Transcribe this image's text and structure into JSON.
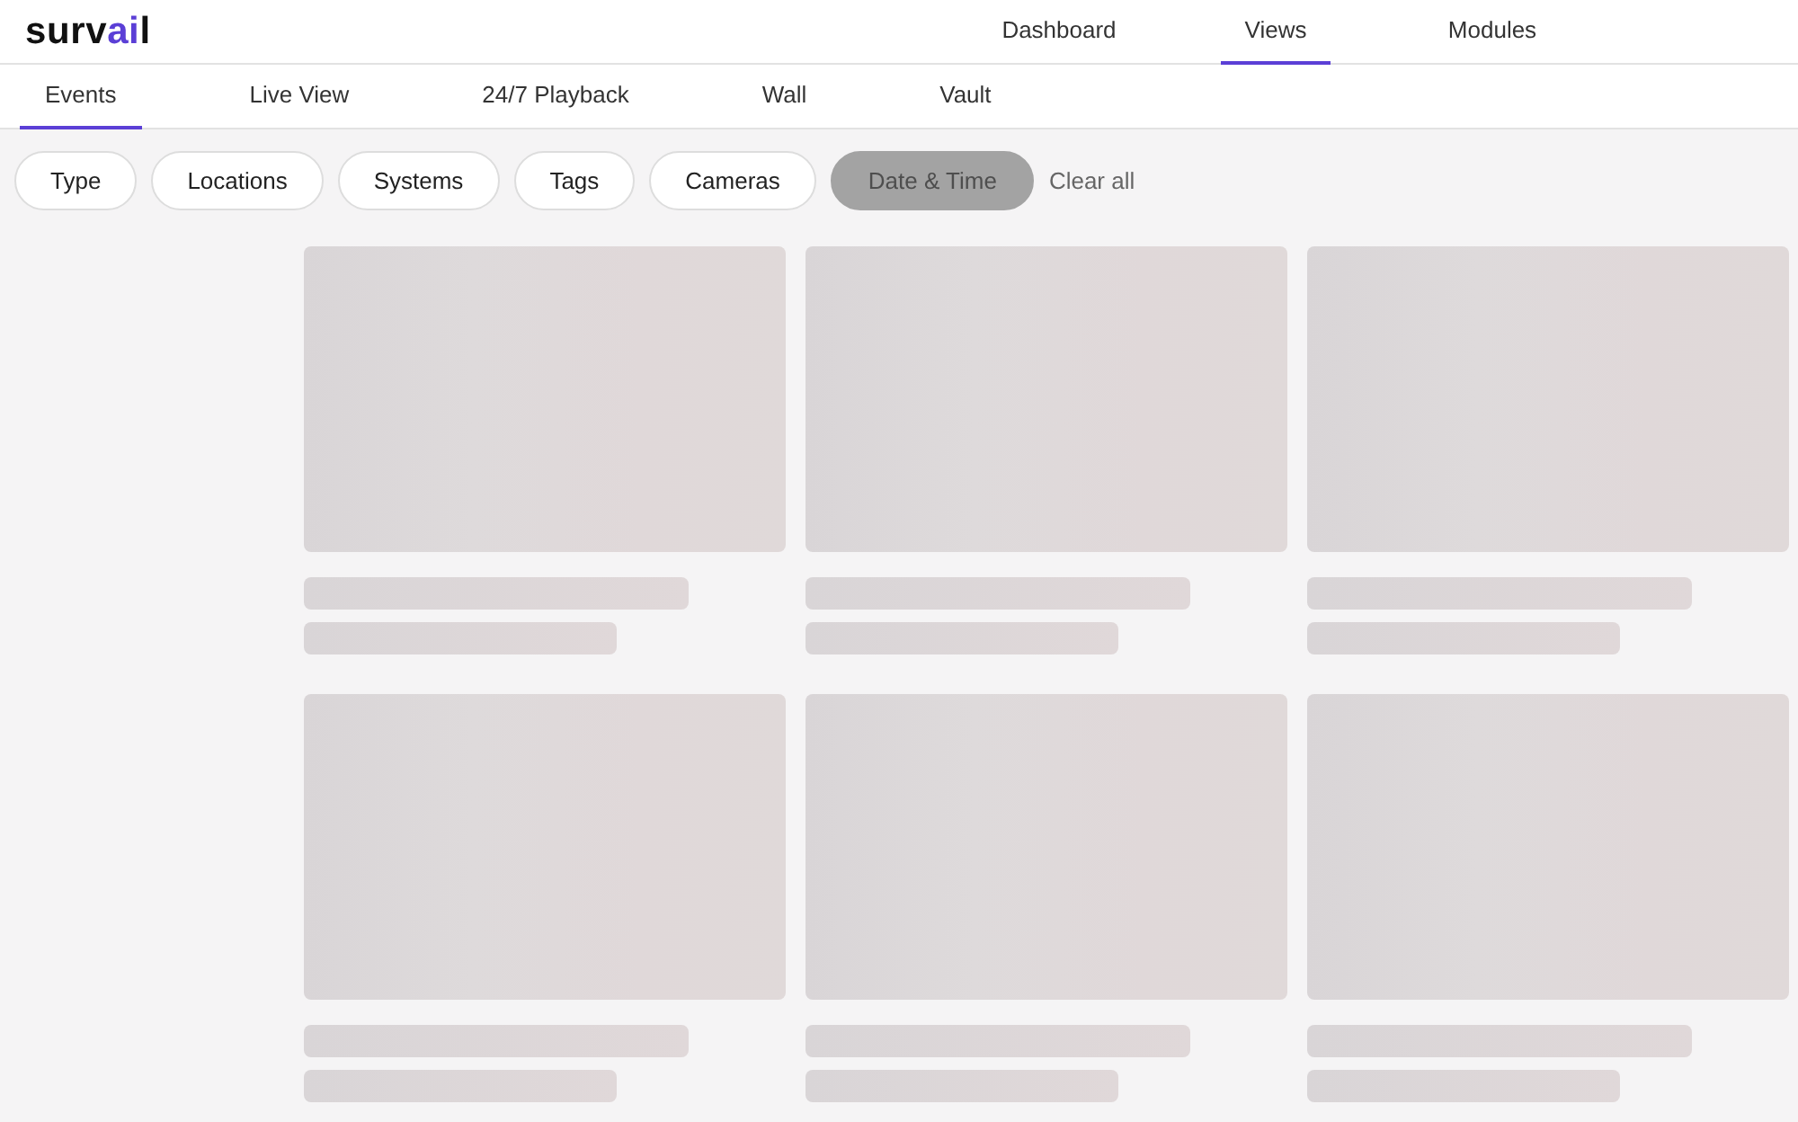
{
  "logo": [
    {
      "text": "surv",
      "accent": false
    },
    {
      "text": "ai",
      "accent": true
    },
    {
      "text": "l",
      "accent": false
    }
  ],
  "main_nav": [
    {
      "label": "Dashboard",
      "selected": false
    },
    {
      "label": "Views",
      "selected": true
    },
    {
      "label": "Modules",
      "selected": false
    }
  ],
  "tabs": [
    {
      "label": "Events",
      "selected": true
    },
    {
      "label": "Live View",
      "selected": false
    },
    {
      "label": "24/7 Playback",
      "selected": false
    },
    {
      "label": "Wall",
      "selected": false
    },
    {
      "label": "Vault",
      "selected": false
    }
  ],
  "filters": [
    {
      "label": "Type",
      "disabled": false
    },
    {
      "label": "Locations",
      "disabled": false
    },
    {
      "label": "Systems",
      "disabled": false
    },
    {
      "label": "Tags",
      "disabled": false
    },
    {
      "label": "Cameras",
      "disabled": false
    },
    {
      "label": "Date & Time",
      "disabled": true
    }
  ],
  "clear_all": "Clear all",
  "event_cards": [
    {
      "kind": "skeleton"
    },
    {
      "kind": "skeleton"
    },
    {
      "kind": "skeleton"
    },
    {
      "kind": "skeleton"
    },
    {
      "kind": "skeleton"
    },
    {
      "kind": "skeleton"
    }
  ]
}
